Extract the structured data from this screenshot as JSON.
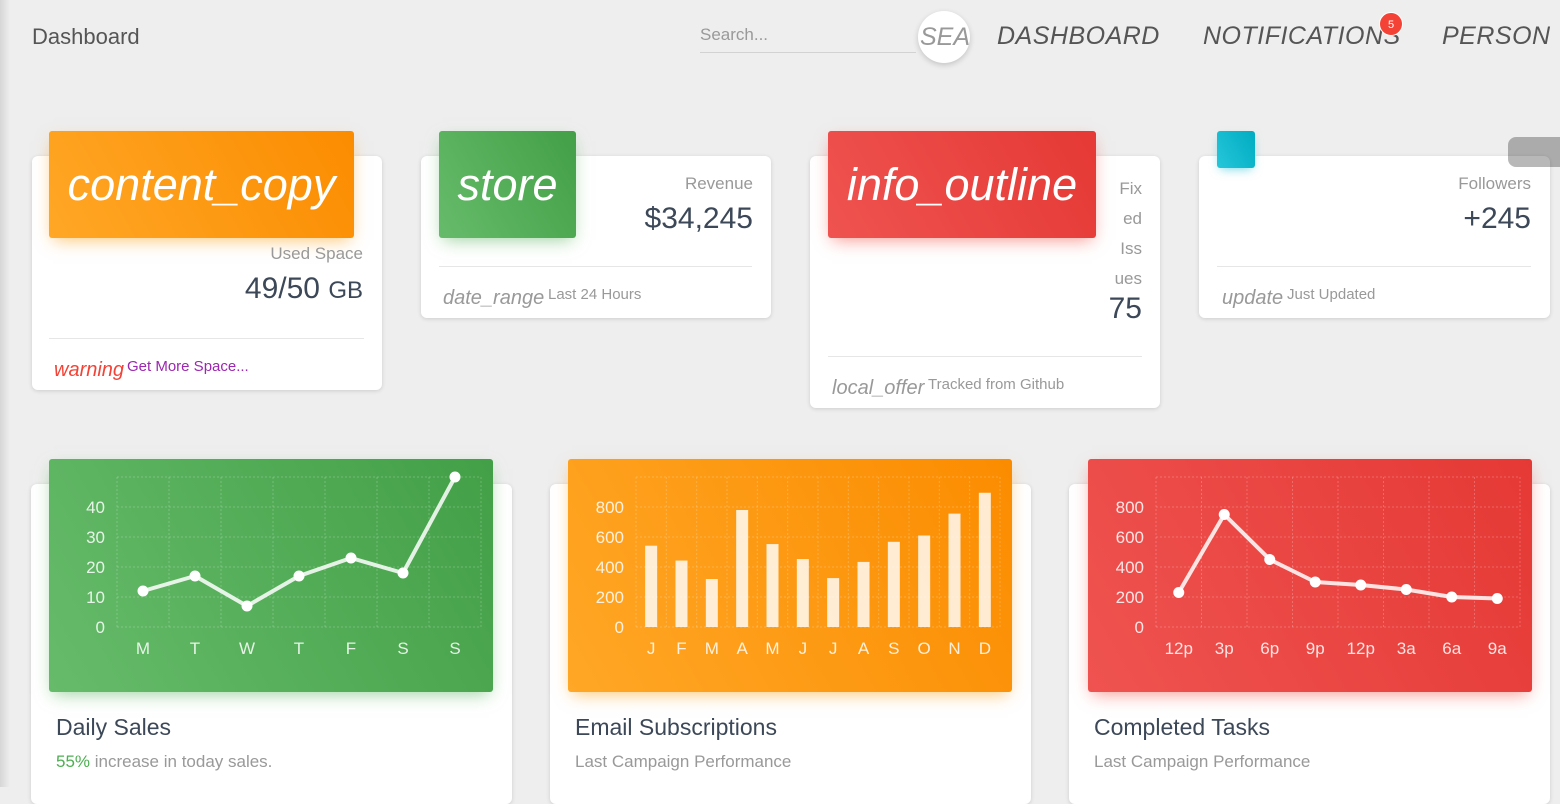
{
  "navbar": {
    "brand": "Dashboard",
    "search_placeholder": "Search...",
    "search_button": "SEA",
    "links": [
      "DASHBOARD",
      "NOTIFICATIONS",
      "PERSON"
    ],
    "notification_count": "5"
  },
  "stats": [
    {
      "icon": "content_copy",
      "category": "Used Space",
      "value": "49/50",
      "unit": "GB",
      "footer_icon": "warning",
      "footer_text": "Get More Space...",
      "color": "#fb8c00"
    },
    {
      "icon": "store",
      "category": "Revenue",
      "value": "$34,245",
      "footer_icon": "date_range",
      "footer_text": "Last 24 Hours",
      "color": "#43a047"
    },
    {
      "icon": "info_outline",
      "category_lines": [
        "Fix",
        "ed",
        "Iss",
        "ues"
      ],
      "value": "75",
      "footer_icon": "local_offer",
      "footer_text": "Tracked from Github",
      "color": "#e53935"
    },
    {
      "icon": "",
      "category": "Followers",
      "value": "+245",
      "footer_icon": "update",
      "footer_text": "Just Updated",
      "color": "#00acc1"
    }
  ],
  "charts": [
    {
      "title": "Daily Sales",
      "subtitle_highlight": "55%",
      "subtitle": " increase in today sales."
    },
    {
      "title": "Email Subscriptions",
      "subtitle": "Last Campaign Performance"
    },
    {
      "title": "Completed Tasks",
      "subtitle": "Last Campaign Performance"
    }
  ],
  "chart_data": [
    {
      "type": "line",
      "categories": [
        "M",
        "T",
        "W",
        "T",
        "F",
        "S",
        "S"
      ],
      "values": [
        12,
        17,
        7,
        17,
        23,
        18,
        50
      ],
      "yticks": [
        0,
        10,
        20,
        30,
        40
      ],
      "ylim": [
        0,
        50
      ],
      "color": "#4caf50"
    },
    {
      "type": "bar",
      "categories": [
        "J",
        "F",
        "M",
        "A",
        "M",
        "J",
        "J",
        "A",
        "S",
        "O",
        "N",
        "D"
      ],
      "values": [
        542,
        443,
        320,
        780,
        553,
        453,
        326,
        434,
        568,
        610,
        756,
        895
      ],
      "yticks": [
        0,
        200,
        400,
        600,
        800
      ],
      "ylim": [
        0,
        1000
      ],
      "color": "#ff9800"
    },
    {
      "type": "line",
      "categories": [
        "12p",
        "3p",
        "6p",
        "9p",
        "12p",
        "3a",
        "6a",
        "9a"
      ],
      "values": [
        230,
        750,
        450,
        300,
        280,
        250,
        200,
        190
      ],
      "yticks": [
        0,
        200,
        400,
        600,
        800
      ],
      "ylim": [
        0,
        1000
      ],
      "color": "#f44336"
    }
  ]
}
